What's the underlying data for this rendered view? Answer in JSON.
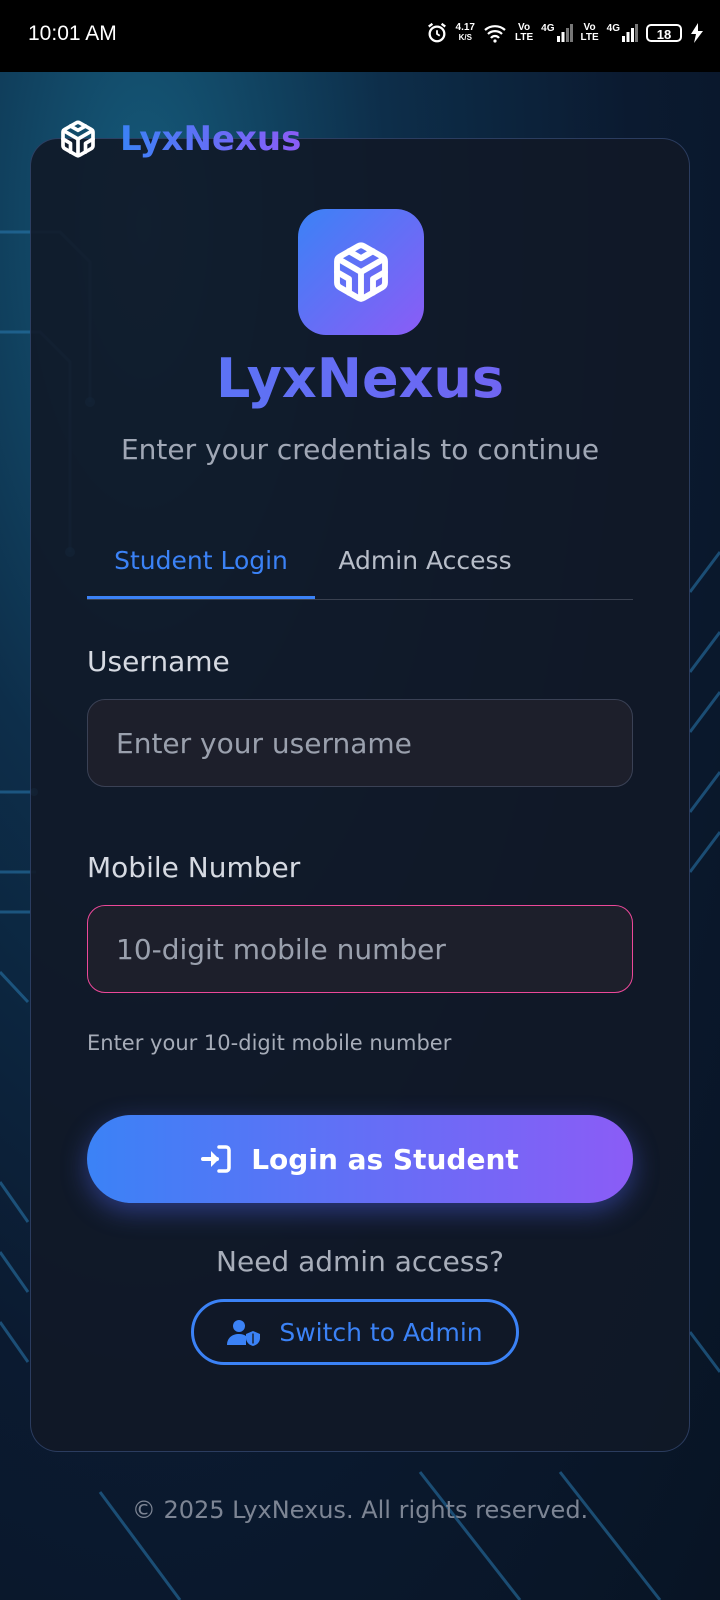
{
  "status_bar": {
    "time": "10:01 AM",
    "net_speed_value": "4.17",
    "net_speed_unit": "K/S",
    "sim1_label_top": "Vo",
    "sim1_label_bottom": "LTE",
    "sim1_network": "4G",
    "sim2_label_top": "Vo",
    "sim2_label_bottom": "LTE",
    "sim2_network": "4G",
    "battery": "18"
  },
  "header": {
    "brand": "LyxNexus"
  },
  "card": {
    "title": "LyxNexus",
    "subtitle": "Enter your credentials to continue",
    "tabs": [
      {
        "label": "Student Login",
        "active": true
      },
      {
        "label": "Admin Access",
        "active": false
      }
    ],
    "username": {
      "label": "Username",
      "placeholder": "Enter your username",
      "value": ""
    },
    "mobile": {
      "label": "Mobile Number",
      "placeholder": "10-digit mobile number",
      "value": "",
      "hint": "Enter your 10-digit mobile number"
    },
    "login_button": "Login as Student",
    "admin_prompt": "Need admin access?",
    "switch_button": "Switch to Admin"
  },
  "footer": "© 2025 LyxNexus. All rights reserved.",
  "colors": {
    "accent_blue": "#3b82f6",
    "accent_purple": "#8b5cf6",
    "error_border": "#ec4899"
  }
}
